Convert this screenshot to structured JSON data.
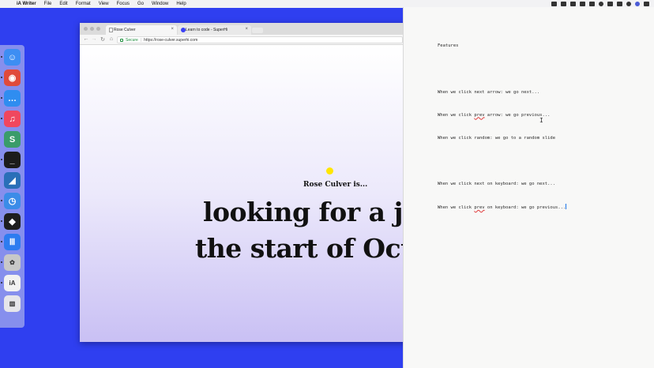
{
  "menubar": {
    "app_name": "iA Writer",
    "menus": [
      "File",
      "Edit",
      "Format",
      "View",
      "Focus",
      "Go",
      "Window",
      "Help"
    ]
  },
  "dock": {
    "apps": [
      {
        "name": "finder-icon",
        "glyph": "☺",
        "color": "#3d8ef3"
      },
      {
        "name": "chrome-icon",
        "glyph": "◉",
        "color": "#e04b3b"
      },
      {
        "name": "messages-icon",
        "glyph": "…",
        "color": "#2f8df0"
      },
      {
        "name": "itunes-icon",
        "glyph": "♫",
        "color": "#f0475e"
      },
      {
        "name": "slack-icon",
        "glyph": "S",
        "color": "#3a9c6a"
      },
      {
        "name": "terminal-icon",
        "glyph": "_",
        "color": "#1c1c1c"
      },
      {
        "name": "vscode-icon",
        "glyph": "◢",
        "color": "#2a6fb8"
      },
      {
        "name": "clock-icon",
        "glyph": "◷",
        "color": "#3b8ce8"
      },
      {
        "name": "figma-icon",
        "glyph": "◆",
        "color": "#1e1e1e"
      },
      {
        "name": "intercom-icon",
        "glyph": "Ⅲ",
        "color": "#2d7cf0"
      },
      {
        "name": "photos-icon",
        "glyph": "✿",
        "color": "#c8c8c8"
      },
      {
        "name": "ia-writer-icon",
        "glyph": "iA",
        "color": "#f2f2f2"
      },
      {
        "name": "trash-icon",
        "glyph": "▥",
        "color": "#e6e6ea"
      }
    ]
  },
  "browser": {
    "tabs": [
      {
        "label": "Rose Culver"
      },
      {
        "label": "Learn to code - SuperHi"
      }
    ],
    "secure_label": "Secure",
    "url": "https://rose-culver.superhi.com",
    "page": {
      "subtitle": "Rose Culver is...",
      "headline_line1": "looking for a jo",
      "headline_line2": "the start of Oct",
      "controls": {
        "prev": "←",
        "random": "⤭",
        "next": "→"
      }
    }
  },
  "writer": {
    "lines": [
      "Features",
      "",
      "When we click next arrow: we go next...",
      "When we click prev arrow: we go previous...",
      "When we click random: we go to a random slide",
      "",
      "When we click next on keyboard: we go next...",
      "When we click prev on keyboard: we go previous..."
    ]
  }
}
